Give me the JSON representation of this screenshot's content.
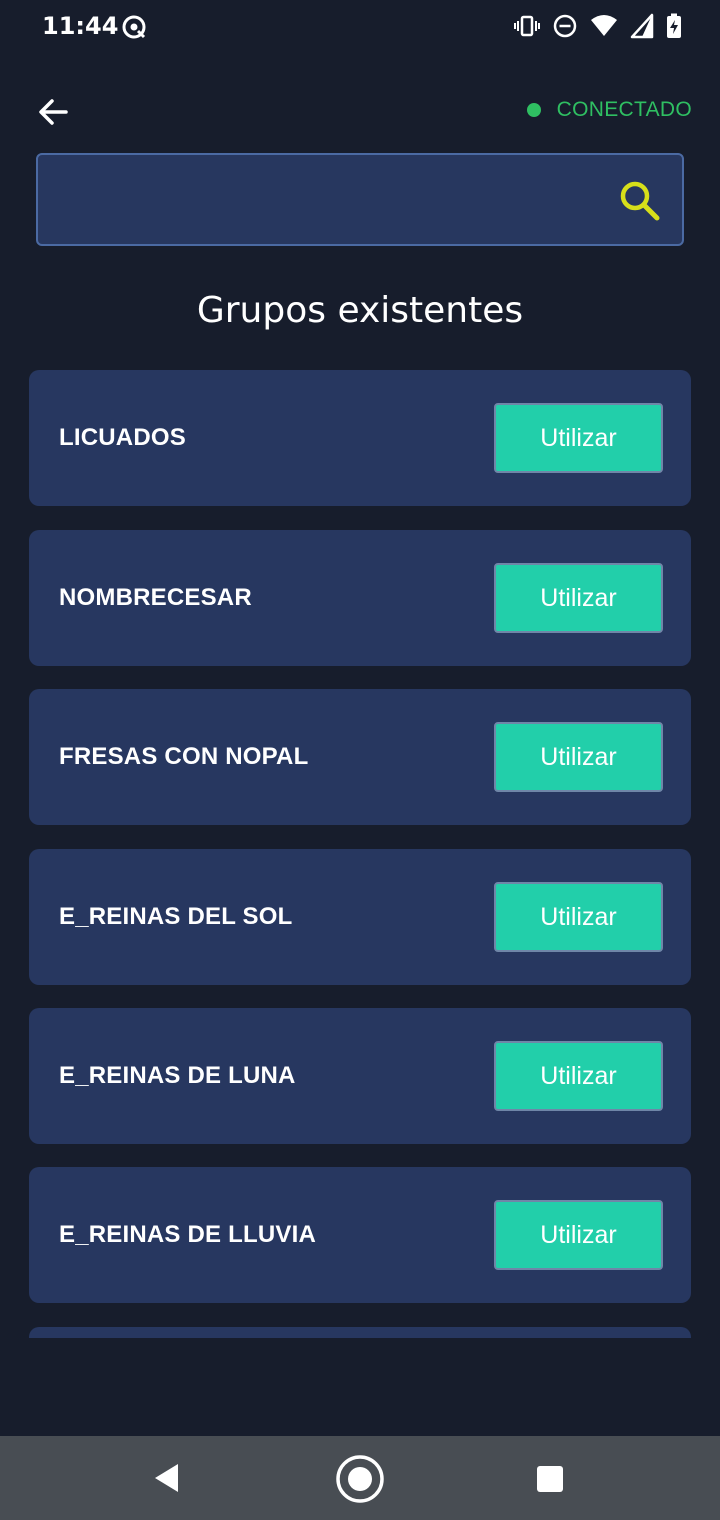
{
  "status_bar": {
    "time": "11:44",
    "left_icon": "data-saver-icon",
    "right_icons": [
      "vibrate-icon",
      "do-not-disturb-icon",
      "wifi-icon",
      "signal-icon",
      "battery-charging-icon"
    ]
  },
  "header": {
    "back_icon": "arrow-back-icon",
    "connection_status": "CONECTADO",
    "connection_color": "#2fbf62"
  },
  "search": {
    "value": "",
    "placeholder": "",
    "icon": "search-icon",
    "icon_color": "#d7df1a"
  },
  "page": {
    "title": "Grupos existentes"
  },
  "groups": [
    {
      "name": "LICUADOS",
      "button_label": "Utilizar"
    },
    {
      "name": "NOMBRECESAR",
      "button_label": "Utilizar"
    },
    {
      "name": "FRESAS CON NOPAL",
      "button_label": "Utilizar"
    },
    {
      "name": "E_REINAS DEL SOL",
      "button_label": "Utilizar"
    },
    {
      "name": "E_REINAS DE LUNA",
      "button_label": "Utilizar"
    },
    {
      "name": "E_REINAS DE LLUVIA",
      "button_label": "Utilizar"
    }
  ],
  "colors": {
    "background": "#171d2c",
    "card": "#273760",
    "accent_button": "#22cfaa"
  },
  "nav_bar": {
    "icons": [
      "nav-back-icon",
      "nav-home-icon",
      "nav-recents-icon"
    ]
  }
}
